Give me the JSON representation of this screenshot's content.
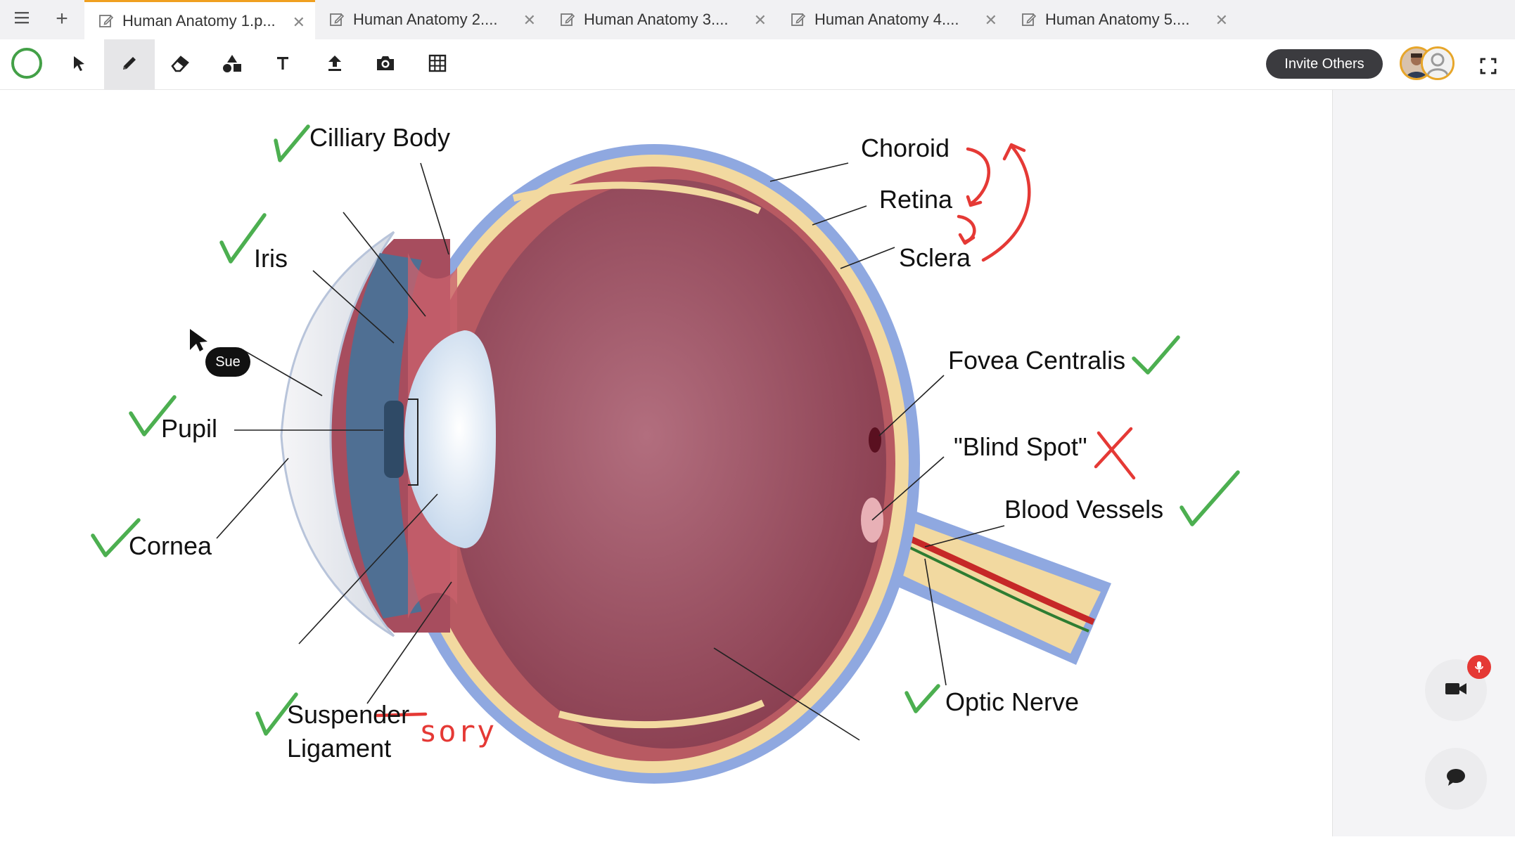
{
  "tabs": [
    {
      "title": "Human Anatomy 1.p...",
      "active": true
    },
    {
      "title": "Human Anatomy 2....",
      "active": false
    },
    {
      "title": "Human Anatomy 3....",
      "active": false
    },
    {
      "title": "Human Anatomy 4....",
      "active": false
    },
    {
      "title": "Human Anatomy 5....",
      "active": false
    }
  ],
  "toolbar": {
    "tools": [
      "circle-tool",
      "select-tool",
      "pen-tool",
      "eraser-tool",
      "shapes-tool",
      "text-tool",
      "upload-tool",
      "camera-tool",
      "table-tool"
    ],
    "selected_tool": "pen-tool",
    "invite_label": "Invite Others"
  },
  "diagram": {
    "labels": {
      "cilliary_body": "Cilliary Body",
      "iris": "Iris",
      "pupil": "Pupil",
      "cornea": "Cornea",
      "suspender": "Suspender",
      "ligament": "Ligament",
      "choroid": "Choroid",
      "retina": "Retina",
      "sclera": "Sclera",
      "fovea": "Fovea Centralis",
      "blind_spot": "\"Blind Spot\"",
      "blood_vessels": "Blood Vessels",
      "optic_nerve": "Optic Nerve"
    },
    "handwritten_correction": "sory"
  },
  "collaborator_cursor": {
    "name": "Sue"
  },
  "colors": {
    "check_green": "#4caf50",
    "annotation_red": "#e53935",
    "accent_tab": "#f0a020",
    "sclera_blue": "#8fa8e0",
    "retina_yellow": "#f2d9a0",
    "choroid_red": "#b85a62",
    "vitreous": "#8e3c50"
  }
}
